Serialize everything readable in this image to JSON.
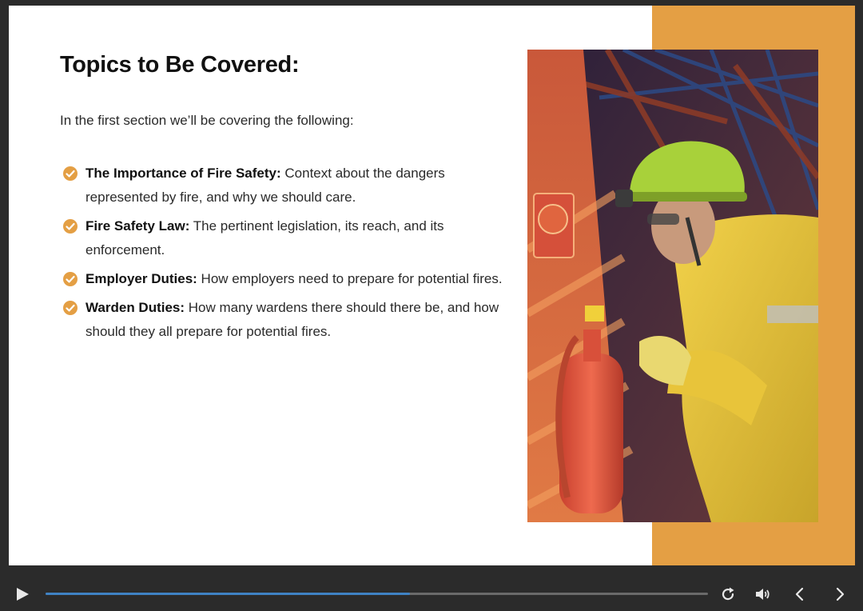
{
  "slide": {
    "title": "Topics to Be Covered:",
    "intro": "In the first section we’ll be covering the following:",
    "topics": [
      {
        "heading": "The Importance of Fire Safety:",
        "text": " Context about the dangers represented by fire, and why we should care."
      },
      {
        "heading": "Fire Safety Law:",
        "text": " The pertinent legislation, its reach, and its enforcement."
      },
      {
        "heading": "Employer Duties:",
        "text": " How employers need to prepare for potential fires."
      },
      {
        "heading": "Warden Duties:",
        "text": " How many wardens there should there be, and how should they all prepare for potential fires."
      }
    ],
    "photo_subject": "worker-inspecting-fire-extinguisher"
  },
  "player": {
    "progress_fraction": 0.55,
    "icons": [
      "play-icon",
      "replay-icon",
      "volume-icon",
      "previous-icon",
      "next-icon"
    ]
  },
  "colors": {
    "accent_orange": "#e49f44",
    "check_orange": "#e49f44",
    "progress_blue": "#3f82c4",
    "player_background": "#2b2b2b"
  }
}
